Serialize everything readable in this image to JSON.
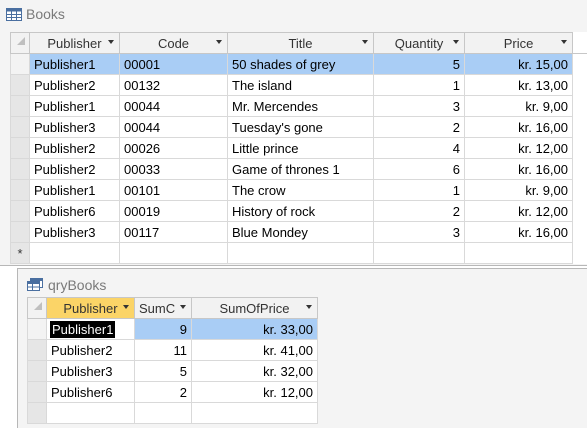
{
  "books": {
    "title": "Books",
    "columns": [
      "Publisher",
      "Code",
      "Title",
      "Quantity",
      "Price"
    ],
    "rows": [
      [
        "Publisher1",
        "00001",
        "50 shades of grey",
        "5",
        "kr. 15,00"
      ],
      [
        "Publisher2",
        "00132",
        "The island",
        "1",
        "kr. 13,00"
      ],
      [
        "Publisher1",
        "00044",
        "Mr. Mercendes",
        "3",
        "kr. 9,00"
      ],
      [
        "Publisher3",
        "00044",
        "Tuesday's gone",
        "2",
        "kr. 16,00"
      ],
      [
        "Publisher2",
        "00026",
        "Little prince",
        "4",
        "kr. 12,00"
      ],
      [
        "Publisher2",
        "00033",
        "Game of thrones 1",
        "6",
        "kr. 16,00"
      ],
      [
        "Publisher1",
        "00101",
        "The crow",
        "1",
        "kr. 9,00"
      ],
      [
        "Publisher6",
        "00019",
        "History of rock",
        "2",
        "kr. 12,00"
      ],
      [
        "Publisher3",
        "00117",
        "Blue Mondey",
        "3",
        "kr. 16,00"
      ]
    ],
    "new_row_marker": "*"
  },
  "qry": {
    "title": "qryBooks",
    "columns": [
      "Publisher",
      "SumC",
      "SumOfPrice"
    ],
    "rows": [
      [
        "Publisher1",
        "9",
        "kr. 33,00"
      ],
      [
        "Publisher2",
        "11",
        "kr. 41,00"
      ],
      [
        "Publisher3",
        "5",
        "kr. 32,00"
      ],
      [
        "Publisher6",
        "2",
        "kr. 12,00"
      ]
    ]
  },
  "colors": {
    "selected_row": "#a9cdf5",
    "sorted_header": "#fbd467",
    "header_bg": "#f2f2f2"
  }
}
